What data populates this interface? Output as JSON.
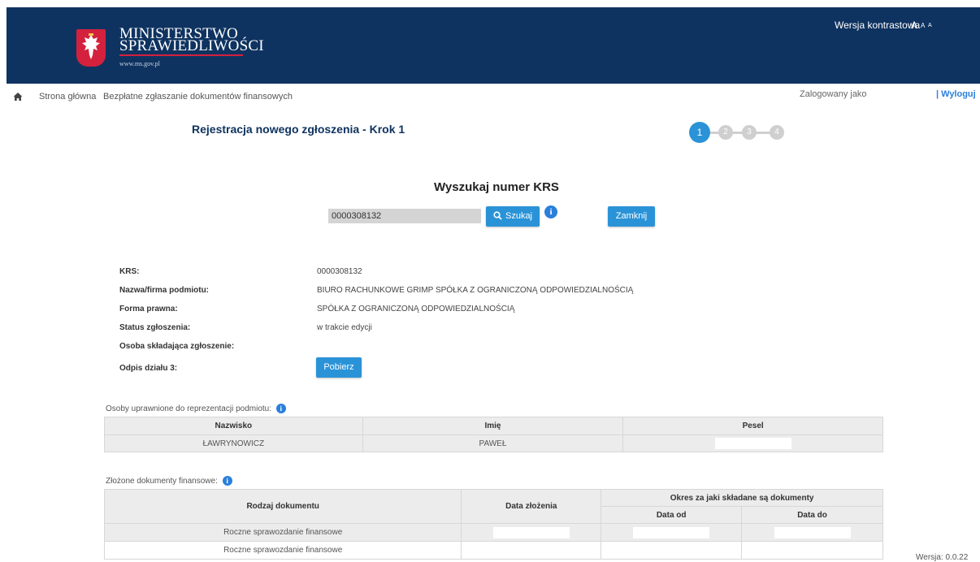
{
  "header": {
    "logo_line1": "MINISTERSTWO",
    "logo_line2": "SPRAWIEDLIWOŚCI",
    "logo_url": "www.ms.gov.pl",
    "contrast_label": "Wersja kontrastowa",
    "font_size_a1": "A",
    "font_size_a2": "A",
    "font_size_a3": "A",
    "brand_color": "#0f3360",
    "accent_color": "#d4213d"
  },
  "nav": {
    "crumbs": [
      "Strona główna",
      "Bezpłatne zgłaszanie dokumentów finansowych"
    ],
    "logged_as": "Zalogowany jako",
    "logout": "| Wyloguj"
  },
  "wizard": {
    "title": "Rejestracja nowego zgłoszenia - Krok 1",
    "steps": [
      "1",
      "2",
      "3",
      "4"
    ],
    "active_step": "1"
  },
  "search": {
    "title": "Wyszukaj numer KRS",
    "input_value": "0000308132",
    "search_button": "Szukaj",
    "close_button": "Zamknij"
  },
  "details": {
    "krs_label": "KRS:",
    "krs_value": "0000308132",
    "name_label": "Nazwa/firma podmiotu:",
    "name_value": "BIURO RACHUNKOWE GRIMP SPÓŁKA Z OGRANICZONĄ ODPOWIEDZIALNOŚCIĄ",
    "legal_form_label": "Forma prawna:",
    "legal_form_value": "SPÓŁKA Z OGRANICZONĄ ODPOWIEDZIALNOŚCIĄ",
    "status_label": "Status zgłoszenia:",
    "status_value": "w trakcie edycji",
    "person_label": "Osoba składająca zgłoszenie:",
    "extract_label": "Odpis działu 3:",
    "download_button": "Pobierz"
  },
  "representatives": {
    "label": "Osoby uprawnione do reprezentacji podmiotu:",
    "columns": [
      "Nazwisko",
      "Imię",
      "Pesel"
    ],
    "rows": [
      {
        "surname": "ŁAWRYNOWICZ",
        "name": "PAWEŁ"
      }
    ]
  },
  "documents": {
    "label": "Złożone dokumenty finansowe:",
    "col_type": "Rodzaj dokumentu",
    "col_date": "Data złożenia",
    "col_period": "Okres za jaki składane są dokumenty",
    "col_from": "Data od",
    "col_to": "Data do",
    "rows": [
      {
        "type": "Roczne sprawozdanie finansowe"
      },
      {
        "type": "Roczne sprawozdanie finansowe"
      }
    ]
  },
  "footer": {
    "version": "Wersja: 0.0.22"
  }
}
